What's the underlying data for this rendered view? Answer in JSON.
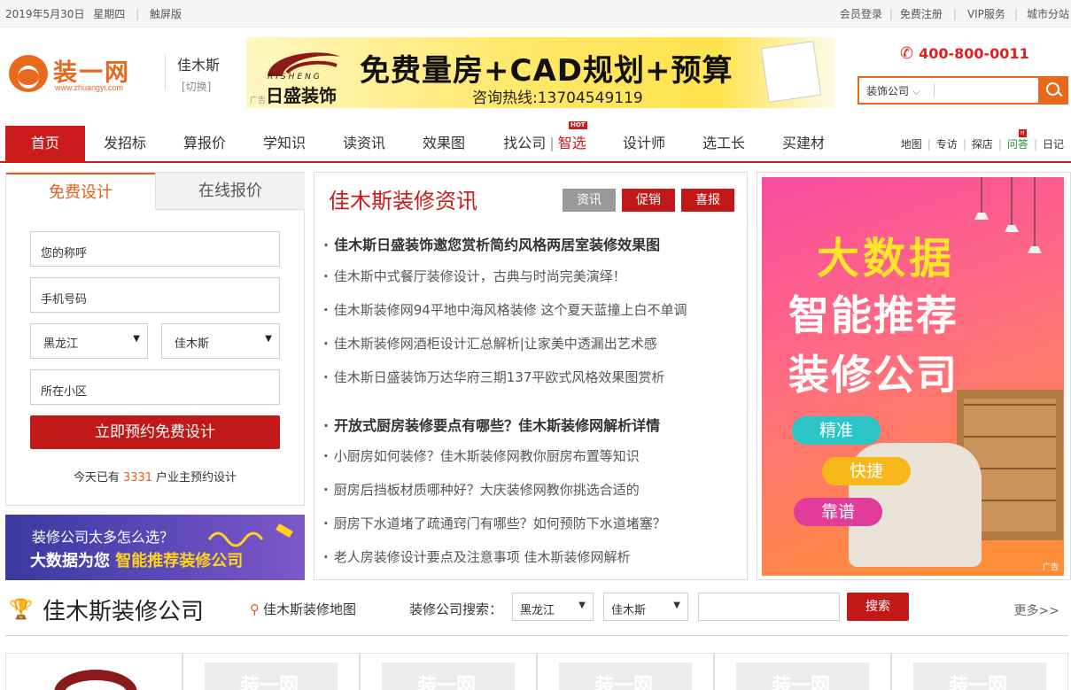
{
  "topbar": {
    "date": "2019年5月30日",
    "weekday": "星期四",
    "touch": "触屏版",
    "links": [
      "会员登录",
      "免费注册",
      "VIP服务",
      "城市分站"
    ]
  },
  "header": {
    "logo_text": "装一网",
    "logo_url": "www.zhuangyi.com",
    "city": "佳木斯",
    "city_switch": "[切换]",
    "phone": "400-800-0011",
    "search_type": "装饰公司",
    "search_placeholder": ""
  },
  "banner": {
    "brand_cn": "日盛装饰",
    "brand_en": "RISHENG",
    "title": "免费量房+CAD规划+预算",
    "hotline": "咨询热线:13704549119",
    "ad_label": "广告"
  },
  "nav": {
    "items": [
      "首页",
      "发招标",
      "算报价",
      "学知识",
      "读资讯",
      "效果图",
      "找公司",
      "智选",
      "设计师",
      "选工长",
      "买建材"
    ],
    "hot_badge": "HOT",
    "right_links": [
      "地图",
      "专访",
      "探店",
      "问答",
      "日记"
    ],
    "right_badge": "H"
  },
  "form": {
    "tabs": [
      "免费设计",
      "在线报价"
    ],
    "name_placeholder": "您的称呼",
    "phone_placeholder": "手机号码",
    "province": "黑龙江",
    "city": "佳木斯",
    "community_placeholder": "所在小区",
    "submit": "立即预约免费设计",
    "count_prefix": "今天已有",
    "count": "3331",
    "count_suffix": "户业主预约设计"
  },
  "promo": {
    "line1": "装修公司太多怎么选？",
    "line2a": "大数据为您",
    "line2b": "智能推荐装修公司"
  },
  "news": {
    "title": "佳木斯装修资讯",
    "tabs": [
      "资讯",
      "促销",
      "喜报"
    ],
    "group1": [
      "佳木斯日盛装饰邀您赏析简约风格两居室装修效果图",
      "佳木斯中式餐厅装修设计，古典与时尚完美演绎！",
      "佳木斯装修网94平地中海风格装修 这个夏天蓝撞上白不单调",
      "佳木斯装修网酒柜设计汇总解析|让家美中透漏出艺术感",
      "佳木斯日盛装饰万达华府三期137平欧式风格效果图赏析"
    ],
    "group2": [
      "开放式厨房装修要点有哪些？佳木斯装修网解析详情",
      "小厨房如何装修？佳木斯装修网教你厨房布置等知识",
      "厨房后挡板材质哪种好？大庆装修网教你挑选合适的",
      "厨房下水道堵了疏通窍门有哪些？如何预防下水道堵塞？",
      "老人房装修设计要点及注意事项 佳木斯装修网解析"
    ]
  },
  "right_ad": {
    "h1": "大数据",
    "h2": "智能推荐",
    "h3": "装修公司",
    "pills": [
      "精准",
      "快捷",
      "靠谱"
    ],
    "ad_label": "广告"
  },
  "companies": {
    "title": "佳木斯装修公司",
    "map_link": "佳木斯装修地图",
    "search_label": "装修公司搜索：",
    "province": "黑龙江",
    "city": "佳木斯",
    "search_button": "搜索",
    "more": "更多>>",
    "placeholder_logo": "装一网"
  }
}
